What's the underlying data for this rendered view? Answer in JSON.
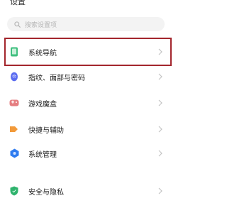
{
  "header": {
    "title": "设置"
  },
  "search": {
    "placeholder": "搜索设置项"
  },
  "items": [
    {
      "label": "系统导航",
      "icon": "navigation-phone-icon",
      "color": "#3fbf7f"
    },
    {
      "label": "指纹、面部与密码",
      "icon": "fingerprint-icon",
      "color": "#5b6cf0"
    },
    {
      "label": "游戏魔盒",
      "icon": "game-box-icon",
      "color": "#e0676b"
    },
    {
      "label": "快捷与辅助",
      "icon": "shortcut-icon",
      "color": "#f29a3a"
    },
    {
      "label": "系统管理",
      "icon": "system-management-icon",
      "color": "#2f7cf0"
    },
    {
      "label": "安全与隐私",
      "icon": "shield-icon",
      "color": "#2fb36d"
    }
  ],
  "highlight": {
    "color": "#a3262d"
  }
}
